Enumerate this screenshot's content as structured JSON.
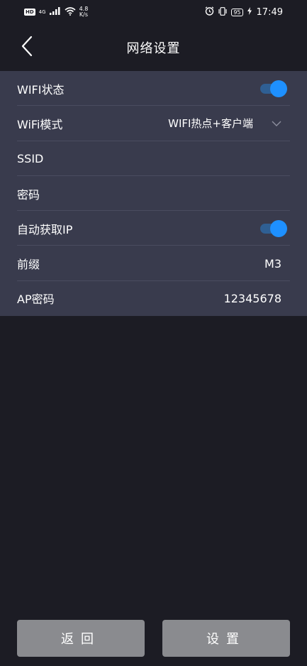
{
  "status_bar": {
    "hd": "HD",
    "signal_gen": "4G",
    "net_speed_value": "4.8",
    "net_speed_unit": "K/s",
    "battery": "95",
    "time": "17:49"
  },
  "header": {
    "title": "网络设置"
  },
  "settings": {
    "wifi_status": {
      "label": "WIFI状态",
      "enabled": true
    },
    "wifi_mode": {
      "label": "WiFi模式",
      "value": "WIFI热点+客户端"
    },
    "ssid": {
      "label": "SSID",
      "value": ""
    },
    "password": {
      "label": "密码",
      "value": ""
    },
    "auto_ip": {
      "label": "自动获取IP",
      "enabled": true
    },
    "prefix": {
      "label": "前缀",
      "value": "M3"
    },
    "ap_password": {
      "label": "AP密码",
      "value": "12345678"
    }
  },
  "buttons": {
    "back": "返回",
    "set": "设置"
  },
  "colors": {
    "background": "#1c1c24",
    "panel": "#393b4d",
    "toggle_knob": "#1e90ff",
    "toggle_track": "#2f5f93",
    "button": "#8a8b8f"
  }
}
